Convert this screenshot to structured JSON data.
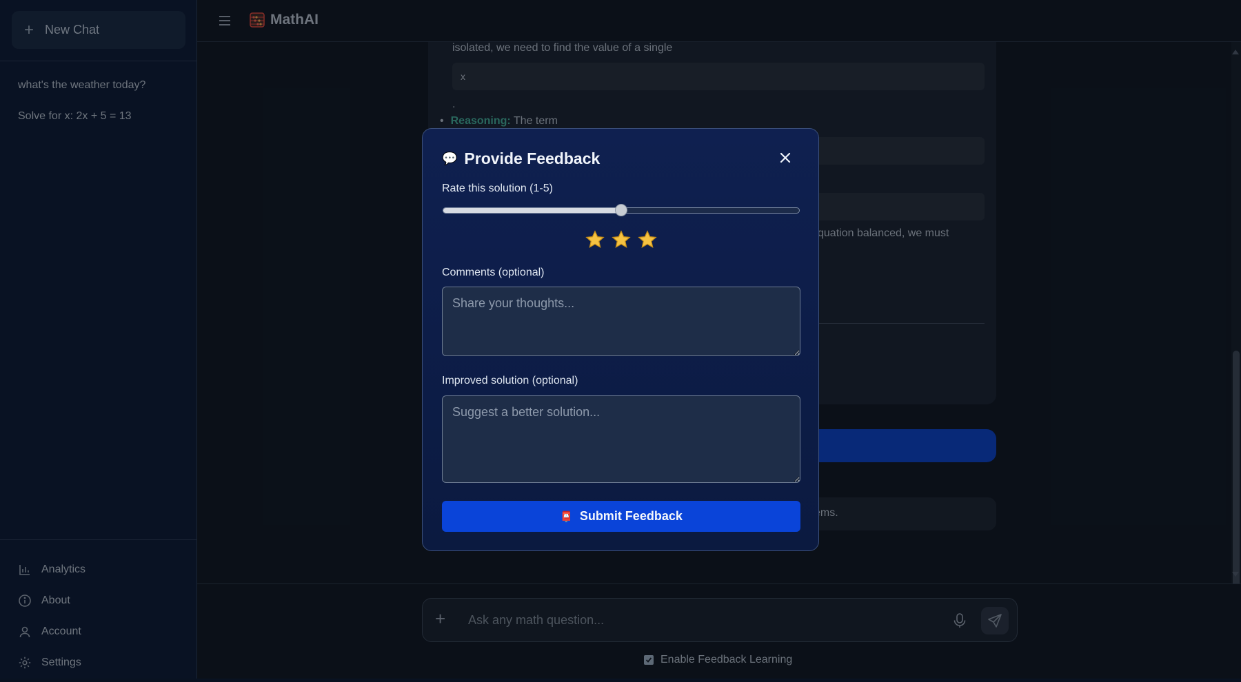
{
  "sidebar": {
    "new_chat_label": "New Chat",
    "history": [
      {
        "label": "what's the weather today?"
      },
      {
        "label": "Solve for x: 2x + 5 = 13"
      }
    ],
    "nav": [
      {
        "label": "Analytics",
        "icon": "bar-chart-icon"
      },
      {
        "label": "About",
        "icon": "info-icon"
      },
      {
        "label": "Account",
        "icon": "user-icon"
      },
      {
        "label": "Settings",
        "icon": "gear-icon"
      }
    ]
  },
  "header": {
    "app_name": "MathAI",
    "logo_icon": "abacus-icon"
  },
  "chat": {
    "line1": "isolated, we need to find the value of a single",
    "code1": "x",
    "period": ".",
    "reasoning_label": "Reasoning:",
    "reasoning_text": "The term",
    "partial_text": "quation balanced, we must",
    "info_text": "ems."
  },
  "composer": {
    "placeholder": "Ask any math question...",
    "feedback_toggle_label": "Enable Feedback Learning",
    "feedback_toggle_checked": true
  },
  "modal": {
    "title": "Provide Feedback",
    "title_icon": "speech-bubble-icon",
    "rating_label": "Rate this solution (1-5)",
    "rating_value": 3,
    "rating_min": 1,
    "rating_max": 5,
    "star_glyph": "⭐",
    "comments_label": "Comments (optional)",
    "comments_placeholder": "Share your thoughts...",
    "improved_label": "Improved solution (optional)",
    "improved_placeholder": "Suggest a better solution...",
    "submit_label": "Submit Feedback",
    "submit_icon": "mailbox-icon"
  },
  "colors": {
    "accent_blue": "#0a44d9",
    "highlight_teal": "#3f9e8f",
    "star_yellow": "#f5c242"
  }
}
